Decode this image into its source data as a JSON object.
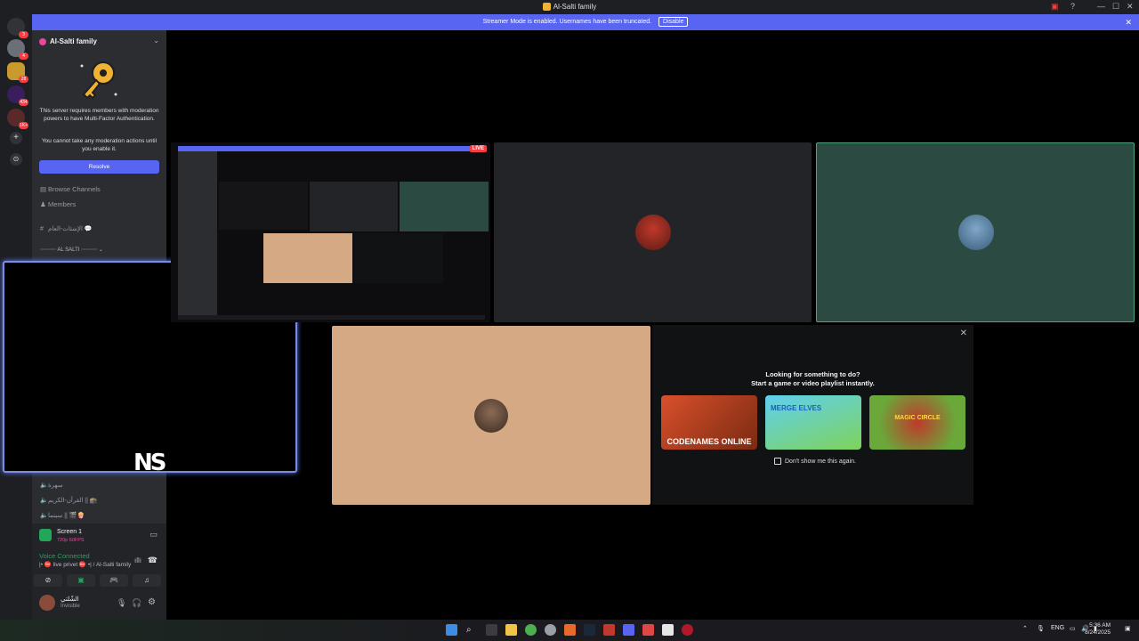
{
  "window": {
    "title": "Al-Salti family",
    "controls": [
      "—",
      "☐",
      "✕"
    ]
  },
  "banner": {
    "message": "Streamer Mode is enabled. Usernames have been truncated.",
    "disable_label": "Disable",
    "close": "✕"
  },
  "guilds": [
    {
      "name": "discord-home-icon",
      "badge": "3"
    },
    {
      "name": "server-1",
      "badge": "4"
    },
    {
      "name": "server-al-salti",
      "badge": "28"
    },
    {
      "name": "server-3",
      "badge": "434"
    },
    {
      "name": "server-4",
      "badge": "1K+"
    }
  ],
  "server": {
    "name": "Al-Salti family",
    "mfa_message": "This server requires members with moderation powers to have Multi-Factor Authentication.",
    "mfa_sub": "You cannot take any moderation actions until you enable it.",
    "resolve_label": "Resolve",
    "browse_channels": "Browse Channels",
    "members": "Members",
    "channel_1": "الإشئات-العام 💬",
    "category": "┈┈┈┈┈ AL SALTI ┈┈┈┈┈ ⌄",
    "voice_1": "سهرة",
    "voice_2": "القرآن-الكريم || 🕋",
    "voice_3": "سينما || 🎬🍿"
  },
  "panel": {
    "screen_title": "Screen 1",
    "screen_sub": "720p 60FPS",
    "voice_status": "Voice Connected",
    "voice_channel": "|• ⛔ live privet ⛔ •| / Al-Salti family",
    "user_name": "الشّلتي",
    "user_status": "Invisible"
  },
  "stage": {
    "live_label": "LIVE"
  },
  "activity": {
    "title": "Looking for something to do?",
    "subtitle": "Start a game or video playlist instantly.",
    "games": [
      {
        "label": "CODENAMES ONLINE"
      },
      {
        "label": "MERGE ELVES"
      },
      {
        "label": "MAGIC CIRCLE"
      }
    ],
    "dont_show": "Don't show me this again.",
    "close": "✕"
  },
  "taskbar": {
    "lang": "ENG",
    "time": "5:36 AM",
    "date": "8/24/2025"
  },
  "colors": {
    "blurple": "#5865f2",
    "green": "#23a55a",
    "red": "#f23f43"
  }
}
